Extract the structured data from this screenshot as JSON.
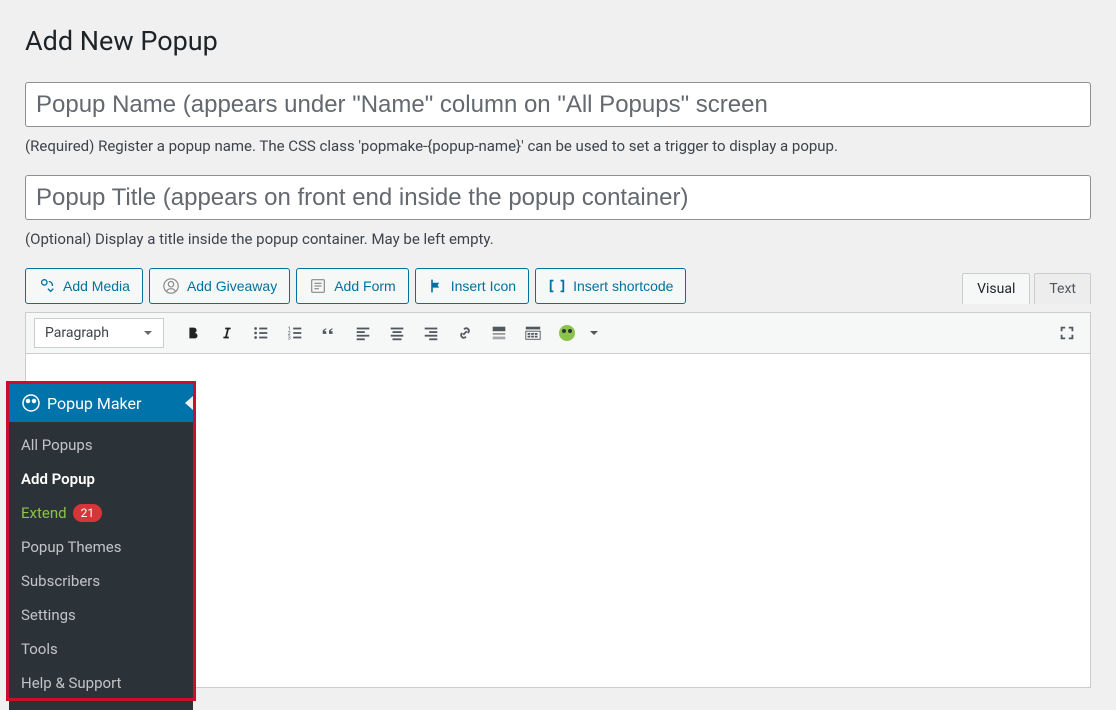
{
  "page": {
    "title": "Add New Popup",
    "name_placeholder": "Popup Name (appears under \"Name\" column on \"All Popups\" screen",
    "name_hint": "(Required) Register a popup name. The CSS class 'popmake-{popup-name}' can be used to set a trigger to display a popup.",
    "title_placeholder": "Popup Title (appears on front end inside the popup container)",
    "title_hint": "(Optional) Display a title inside the popup container. May be left empty."
  },
  "media_buttons": {
    "add_media": "Add Media",
    "add_giveaway": "Add Giveaway",
    "add_form": "Add Form",
    "insert_icon": "Insert Icon",
    "insert_shortcode": "Insert shortcode"
  },
  "editor_tabs": {
    "visual": "Visual",
    "text": "Text"
  },
  "toolbar": {
    "format": "Paragraph"
  },
  "sidebar": {
    "header": "Popup Maker",
    "items": {
      "all_popups": "All Popups",
      "add_popup": "Add Popup",
      "extend": "Extend",
      "extend_count": "21",
      "popup_themes": "Popup Themes",
      "subscribers": "Subscribers",
      "settings": "Settings",
      "tools": "Tools",
      "help": "Help & Support"
    }
  }
}
